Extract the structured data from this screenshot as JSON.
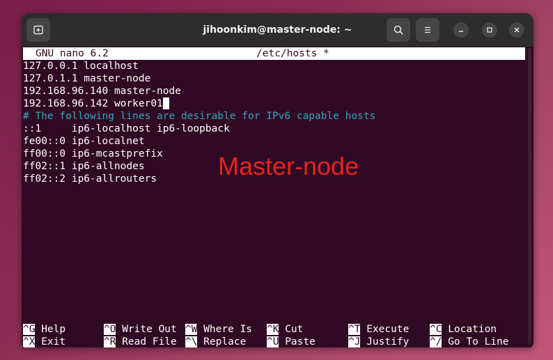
{
  "window": {
    "title": "jihoonkim@master-node: ~"
  },
  "titlebar": {
    "new_tab_icon": "new-tab-icon",
    "search_icon": "search-icon",
    "menu_icon": "hamburger-menu-icon",
    "minimize_icon": "minimize-icon",
    "maximize_icon": "maximize-icon",
    "close_icon": "close-icon"
  },
  "nano": {
    "version": "GNU nano 6.2",
    "filename": "/etc/hosts *",
    "lines": [
      "127.0.0.1 localhost",
      "127.0.1.1 master-node",
      "192.168.96.140 master-node",
      "192.168.96.142 worker01",
      "# The following lines are desirable for IPv6 capable hosts",
      "::1     ip6-localhost ip6-loopback",
      "fe00::0 ip6-localnet",
      "ff00::0 ip6-mcastprefix",
      "ff02::1 ip6-allnodes",
      "ff02::2 ip6-allrouters"
    ],
    "shortcuts_row1": [
      {
        "key": "^G",
        "label": "Help"
      },
      {
        "key": "^O",
        "label": "Write Out"
      },
      {
        "key": "^W",
        "label": "Where Is"
      },
      {
        "key": "^K",
        "label": "Cut"
      },
      {
        "key": "^T",
        "label": "Execute"
      },
      {
        "key": "^C",
        "label": "Location"
      }
    ],
    "shortcuts_row2": [
      {
        "key": "^X",
        "label": "Exit"
      },
      {
        "key": "^R",
        "label": "Read File"
      },
      {
        "key": "^\\",
        "label": "Replace"
      },
      {
        "key": "^U",
        "label": "Paste"
      },
      {
        "key": "^J",
        "label": "Justify"
      },
      {
        "key": "^/",
        "label": "Go To Line"
      }
    ]
  },
  "annotation": {
    "text": "Master-node",
    "color": "#e8231e"
  },
  "colors": {
    "terminal_bg": "#300a24",
    "comment": "#34a7c1",
    "titlebar": "#2d2d2d"
  }
}
